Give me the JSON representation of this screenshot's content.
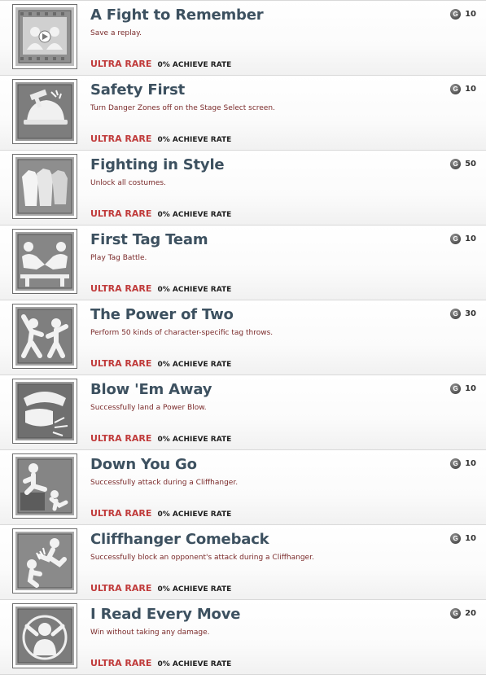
{
  "colors": {
    "title": "#3d5160",
    "description": "#7a2a2a",
    "rarity": "#c03a3a",
    "icon_frame": "#6d6d6d",
    "gamerscore_icon": "#4f4f4f"
  },
  "achievements": [
    {
      "title": "A Fight to Remember",
      "description": "Save a replay.",
      "rarity": "ULTRA RARE",
      "rate": "0% ACHIEVE RATE",
      "gamerscore": "10",
      "icon": "replay-film-icon"
    },
    {
      "title": "Safety First",
      "description": "Turn Danger Zones off on the Stage Select screen.",
      "rarity": "ULTRA RARE",
      "rate": "0% ACHIEVE RATE",
      "gamerscore": "10",
      "icon": "hard-hat-icon"
    },
    {
      "title": "Fighting in Style",
      "description": "Unlock all costumes.",
      "rarity": "ULTRA RARE",
      "rate": "0% ACHIEVE RATE",
      "gamerscore": "50",
      "icon": "costumes-icon"
    },
    {
      "title": "First Tag Team",
      "description": "Play Tag Battle.",
      "rarity": "ULTRA RARE",
      "rate": "0% ACHIEVE RATE",
      "gamerscore": "10",
      "icon": "arm-wrestle-icon"
    },
    {
      "title": "The Power of Two",
      "description": "Perform 50 kinds of character-specific tag throws.",
      "rarity": "ULTRA RARE",
      "rate": "0% ACHIEVE RATE",
      "gamerscore": "30",
      "icon": "tag-throw-icon"
    },
    {
      "title": "Blow 'Em Away",
      "description": "Successfully land a Power Blow.",
      "rarity": "ULTRA RARE",
      "rate": "0% ACHIEVE RATE",
      "gamerscore": "10",
      "icon": "power-blow-icon"
    },
    {
      "title": "Down You Go",
      "description": "Successfully attack during a Cliffhanger.",
      "rarity": "ULTRA RARE",
      "rate": "0% ACHIEVE RATE",
      "gamerscore": "10",
      "icon": "cliff-kick-icon"
    },
    {
      "title": "Cliffhanger Comeback",
      "description": "Successfully block an opponent's attack during a Cliffhanger.",
      "rarity": "ULTRA RARE",
      "rate": "0% ACHIEVE RATE",
      "gamerscore": "10",
      "icon": "cliff-block-icon"
    },
    {
      "title": "I Read Every Move",
      "description": "Win without taking any damage.",
      "rarity": "ULTRA RARE",
      "rate": "0% ACHIEVE RATE",
      "gamerscore": "20",
      "icon": "no-damage-icon"
    }
  ]
}
